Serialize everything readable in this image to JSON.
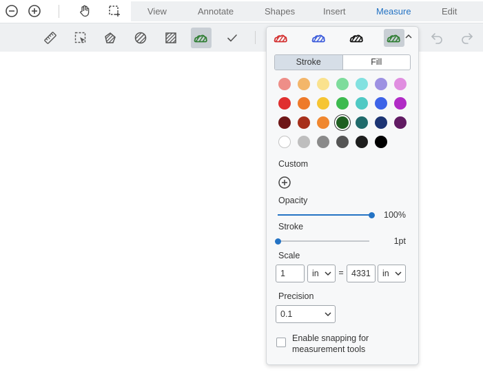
{
  "topbar": {
    "icons": [
      "zoom-out-icon",
      "zoom-in-icon",
      "pan-hand-icon",
      "marquee-select-icon"
    ],
    "tabs": [
      {
        "label": "View",
        "active": false
      },
      {
        "label": "Annotate",
        "active": false
      },
      {
        "label": "Shapes",
        "active": false
      },
      {
        "label": "Insert",
        "active": false
      },
      {
        "label": "Measure",
        "active": true
      },
      {
        "label": "Edit",
        "active": false
      }
    ]
  },
  "measure_toolbar": {
    "icons": [
      "distance-ruler-icon",
      "rectangle-measure-icon",
      "polygon-area-icon",
      "ellipse-area-icon",
      "rectangle-area-icon",
      "cloud-style-icon",
      "checkmark-icon"
    ],
    "active_index": 5,
    "right_icons": [
      "undo-icon",
      "redo-icon"
    ]
  },
  "style_panel": {
    "presets": [
      {
        "color": "#d32f2f"
      },
      {
        "color": "#3b5bdb"
      },
      {
        "color": "#111111"
      },
      {
        "color": "#2e7d32"
      }
    ],
    "active_preset": 3,
    "tabs": {
      "stroke": "Stroke",
      "fill": "Fill",
      "active": "stroke"
    },
    "colors": [
      [
        "#ee8e88",
        "#f3b66a",
        "#fae28e",
        "#7edc9c",
        "#82e1e0",
        "#9d91e2",
        "#e08ee0"
      ],
      [
        "#e02f2f",
        "#ee7a2a",
        "#f6c533",
        "#3cba4f",
        "#4fc9c4",
        "#3d63e8",
        "#b12bc6"
      ],
      [
        "#6e1717",
        "#a7301b",
        "#f0872f",
        "#1f5f22",
        "#1f6a6b",
        "#1c3473",
        "#611b63"
      ],
      [
        "#ffffff",
        "#bebebe",
        "#8a8a8a",
        "#555555",
        "#1d1d1d",
        "#000000"
      ]
    ],
    "selected_color": "#1f5f22",
    "custom_label": "Custom",
    "opacity": {
      "label": "Opacity",
      "value_text": "100%",
      "value": 100
    },
    "stroke_width": {
      "label": "Stroke",
      "value_text": "1pt",
      "value": 1
    },
    "scale": {
      "label": "Scale",
      "left_value": "1",
      "left_unit": "in",
      "equals": "=",
      "right_value": "4331",
      "right_unit": "in"
    },
    "precision": {
      "label": "Precision",
      "value": "0.1"
    },
    "snapping": {
      "label": "Enable snapping for measurement tools",
      "checked": false
    }
  },
  "colors": {
    "accent": "#2473c4",
    "toolbar_bg": "#eef0f2",
    "active_bg": "#c9cfd5"
  }
}
